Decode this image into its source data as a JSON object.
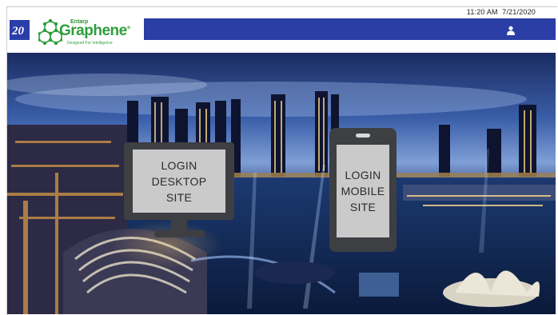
{
  "header": {
    "time": "11:20 AM",
    "date": "7/21/2020",
    "logo_mark_text": "20",
    "brand": {
      "top_text": "Entarp",
      "name": "Graphene",
      "registered": "®",
      "tagline": "Designed For Intelligence"
    },
    "user_icon": "user-icon",
    "bar_color": "#2a3ea6"
  },
  "login": {
    "desktop": {
      "line1": "LOGIN",
      "line2": "DESKTOP",
      "line3": "SITE"
    },
    "mobile": {
      "line1": "LOGIN",
      "line2": "MOBILE",
      "line3": "SITE"
    }
  },
  "background": {
    "icon": "city-skyline-night-image"
  }
}
